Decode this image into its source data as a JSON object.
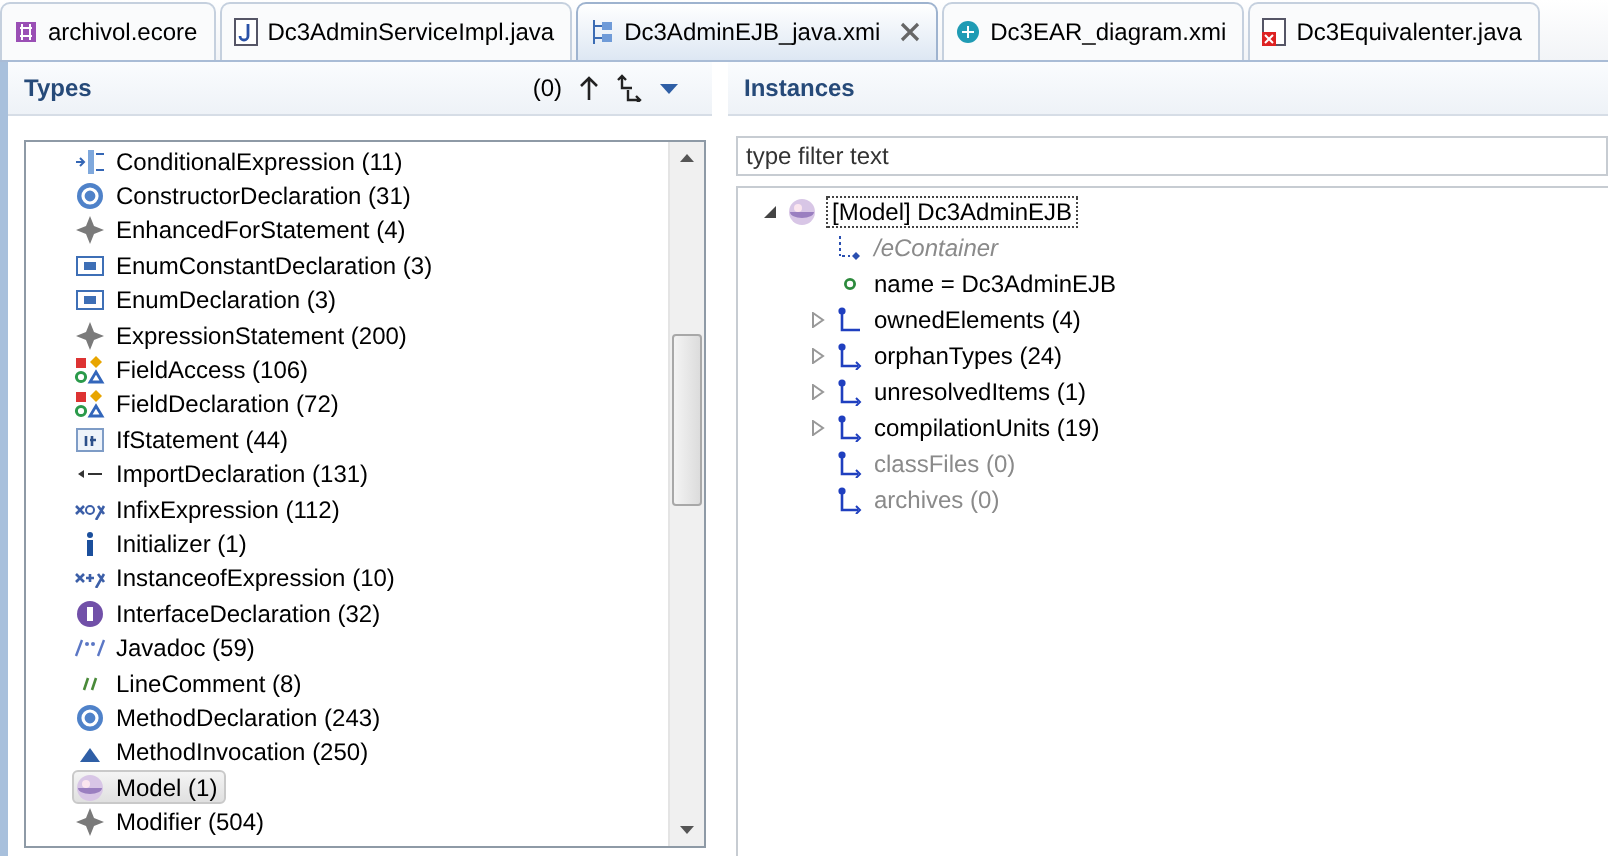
{
  "tabs": [
    {
      "label": "archivol.ecore",
      "kind": "ecore",
      "selected": false
    },
    {
      "label": "Dc3AdminServiceImpl.java",
      "kind": "java",
      "selected": false
    },
    {
      "label": "Dc3AdminEJB_java.xmi",
      "kind": "xmi",
      "selected": true
    },
    {
      "label": "Dc3EAR_diagram.xmi",
      "kind": "diagram",
      "selected": false
    },
    {
      "label": "Dc3Equivalenter.java",
      "kind": "javaerror",
      "selected": false
    }
  ],
  "types": {
    "title": "Types",
    "count": "(0)",
    "items": [
      {
        "label": "ConditionalExpression (11)",
        "kind": "conditional",
        "selected": false
      },
      {
        "label": "ConstructorDeclaration (31)",
        "kind": "method",
        "selected": false
      },
      {
        "label": "EnhancedForStatement (4)",
        "kind": "statement",
        "selected": false
      },
      {
        "label": "EnumConstantDeclaration (3)",
        "kind": "enum",
        "selected": false
      },
      {
        "label": "EnumDeclaration (3)",
        "kind": "enum",
        "selected": false
      },
      {
        "label": "ExpressionStatement (200)",
        "kind": "statement",
        "selected": false
      },
      {
        "label": "FieldAccess (106)",
        "kind": "field",
        "selected": false
      },
      {
        "label": "FieldDeclaration (72)",
        "kind": "field",
        "selected": false
      },
      {
        "label": "IfStatement (44)",
        "kind": "if",
        "selected": false
      },
      {
        "label": "ImportDeclaration (131)",
        "kind": "import",
        "selected": false
      },
      {
        "label": "InfixExpression (112)",
        "kind": "infix",
        "selected": false
      },
      {
        "label": "Initializer (1)",
        "kind": "info",
        "selected": false
      },
      {
        "label": "InstanceofExpression (10)",
        "kind": "instanceof",
        "selected": false
      },
      {
        "label": "InterfaceDeclaration (32)",
        "kind": "interface",
        "selected": false
      },
      {
        "label": "Javadoc (59)",
        "kind": "javadoc",
        "selected": false
      },
      {
        "label": "LineComment (8)",
        "kind": "comment",
        "selected": false
      },
      {
        "label": "MethodDeclaration (243)",
        "kind": "method",
        "selected": false
      },
      {
        "label": "MethodInvocation (250)",
        "kind": "invocation",
        "selected": false
      },
      {
        "label": "Model (1)",
        "kind": "model",
        "selected": true
      },
      {
        "label": "Modifier (504)",
        "kind": "statement",
        "selected": false
      }
    ]
  },
  "instances": {
    "title": "Instances",
    "filter": {
      "placeholder": "type filter text"
    },
    "tree": [
      {
        "label": "[Model] Dc3AdminEJB",
        "kind": "model",
        "expanded": true,
        "children": [
          {
            "label": "/eContainer",
            "kind": "derived",
            "disabled": true
          },
          {
            "label": "name = Dc3AdminEJB",
            "kind": "attribute",
            "disabled": false
          },
          {
            "label": "ownedElements (4)",
            "kind": "containment",
            "disabled": false,
            "expanded": false
          },
          {
            "label": "orphanTypes (24)",
            "kind": "reference",
            "disabled": false,
            "expanded": false
          },
          {
            "label": "unresolvedItems (1)",
            "kind": "reference",
            "disabled": false,
            "expanded": false
          },
          {
            "label": "compilationUnits (19)",
            "kind": "reference",
            "disabled": false,
            "expanded": false
          },
          {
            "label": "classFiles (0)",
            "kind": "reference",
            "disabled": true
          },
          {
            "label": "archives (0)",
            "kind": "reference",
            "disabled": true
          }
        ]
      }
    ]
  }
}
